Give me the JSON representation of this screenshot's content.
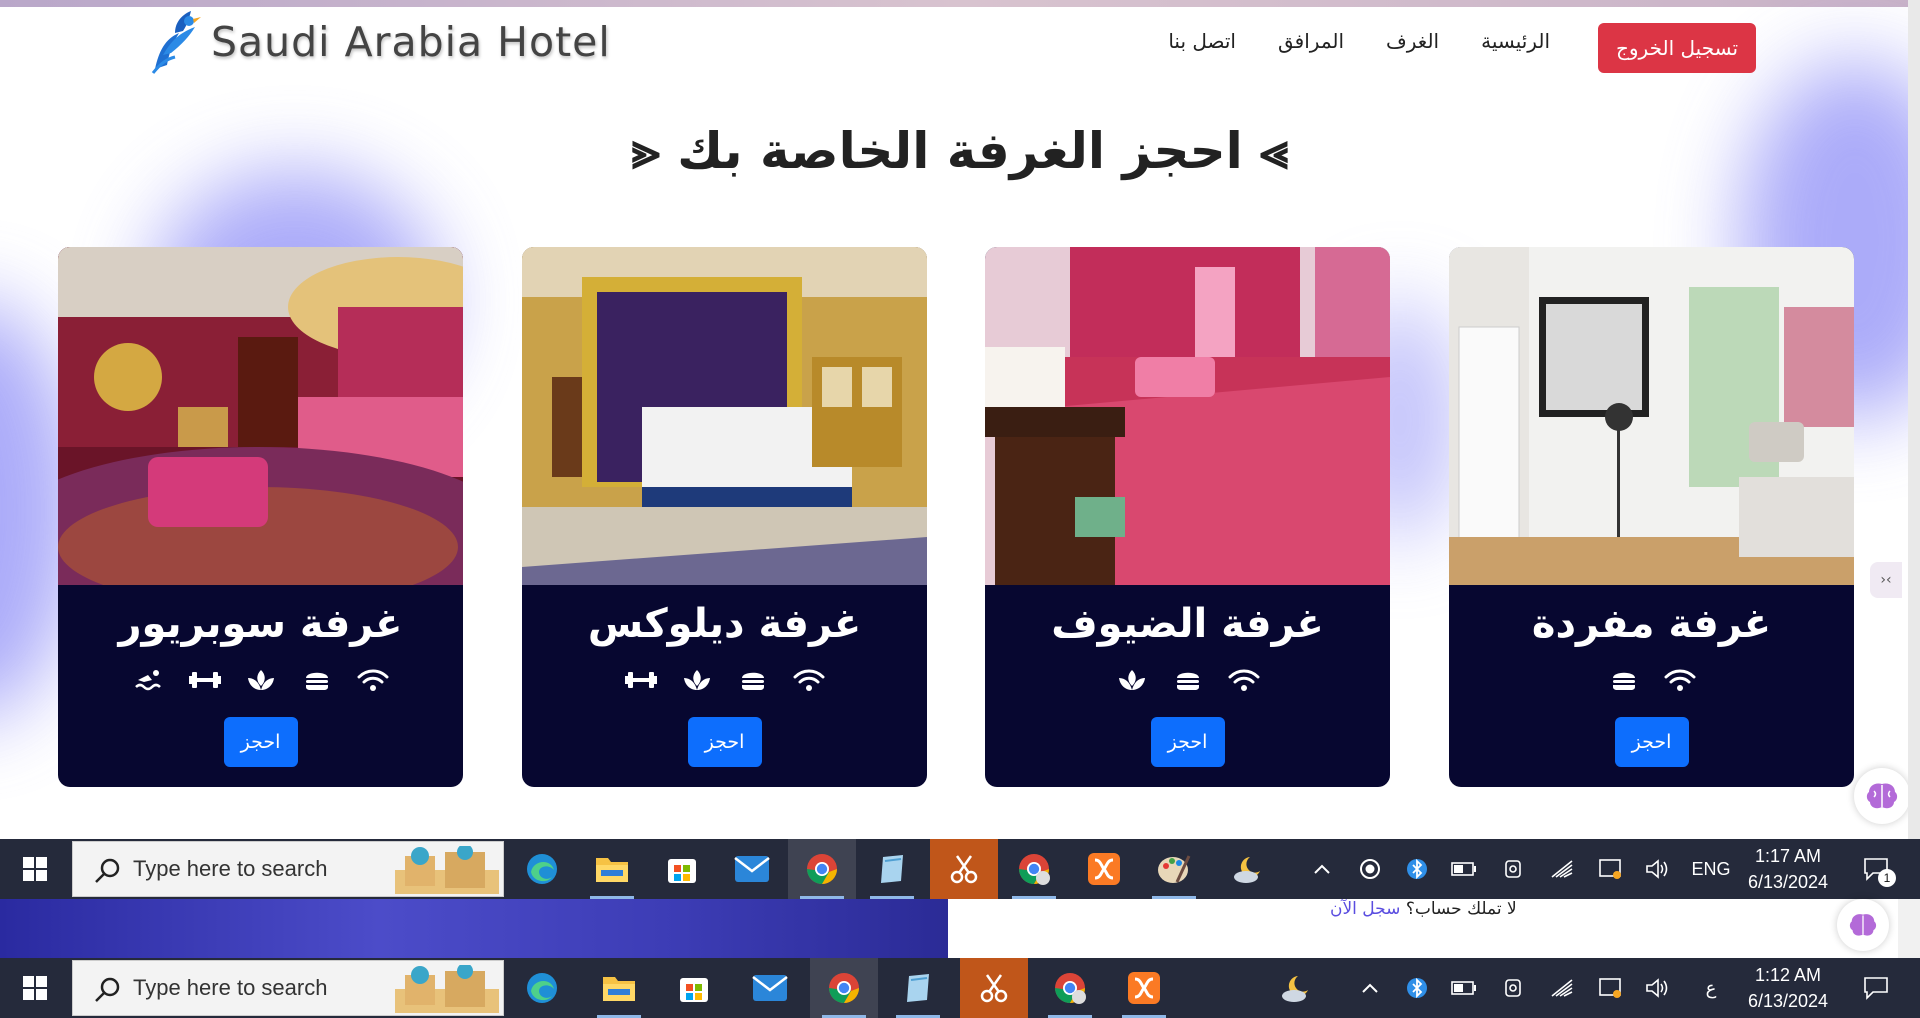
{
  "site": {
    "logo_text": "Saudi Arabia Hotel",
    "nav": [
      "الرئيسية",
      "الغرف",
      "المرافق",
      "اتصل بنا"
    ],
    "logout_label": "تسجيل الخروج",
    "heading": "⪢ احجز الغرفة الخاصة بك ⪡",
    "book_label": "احجز",
    "cards": [
      {
        "title": "غرفة سوبريور",
        "amenities": [
          "wifi-icon",
          "food-icon",
          "spa-icon",
          "gym-icon",
          "pool-icon"
        ]
      },
      {
        "title": "غرفة ديلوكس",
        "amenities": [
          "wifi-icon",
          "food-icon",
          "spa-icon",
          "gym-icon"
        ]
      },
      {
        "title": "غرفة الضيوف",
        "amenities": [
          "wifi-icon",
          "food-icon",
          "spa-icon"
        ]
      },
      {
        "title": "غرفة مفردة",
        "amenities": [
          "wifi-icon",
          "food-icon"
        ]
      }
    ],
    "colors": {
      "accent_glow": "#8f8ff7",
      "card_bg": "#070730",
      "book_btn": "#0d6efd",
      "logout_btn": "#dc3545"
    }
  },
  "behind_window": {
    "no_account_text": "لا تملك حساب؟",
    "register_link": "سجل الآن"
  },
  "taskbar_front": {
    "search_placeholder": "Type here to search",
    "apps": [
      "edge-icon",
      "file-explorer-icon",
      "store-icon",
      "mail-icon",
      "chrome-icon",
      "notepad-icon",
      "snip-icon",
      "chrome-profile-icon",
      "xampp-icon",
      "paint-icon",
      "weather-icon"
    ],
    "language": "ENG",
    "time": "1:17 AM",
    "date": "6/13/2024",
    "notification_count": "1"
  },
  "taskbar_back": {
    "search_placeholder": "Type here to search",
    "language": "ع",
    "time": "1:12 AM",
    "date": "6/13/2024"
  }
}
